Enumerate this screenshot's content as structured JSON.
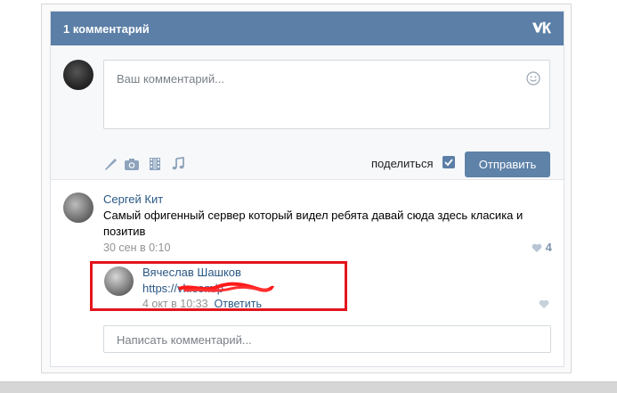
{
  "header": {
    "title": "1 комментарий",
    "logo_icon": "vk-logo-icon"
  },
  "composer": {
    "placeholder": "Ваш комментарий...",
    "tools": [
      "brush-icon",
      "camera-icon",
      "film-icon",
      "music-note-icon"
    ],
    "share_label": "поделиться",
    "share_checked": true,
    "send_label": "Отправить"
  },
  "comments": [
    {
      "author": "Сергей Кит",
      "text": "Самый офигенный сервер который видел ребята давай сюда здесь класика и позитив",
      "date": "30 сен в 0:10",
      "likes": "4"
    },
    {
      "author": "Вячеслав Шашков",
      "text": "https://vk.com/p",
      "date": "4 окт в 10:33",
      "reply_label": "Ответить"
    }
  ],
  "reply_box": {
    "placeholder": "Написать комментарий..."
  },
  "colors": {
    "header_bg": "#5b7fa6",
    "link": "#2a5885",
    "highlight": "#e3141c",
    "button": "#5e82a8"
  }
}
